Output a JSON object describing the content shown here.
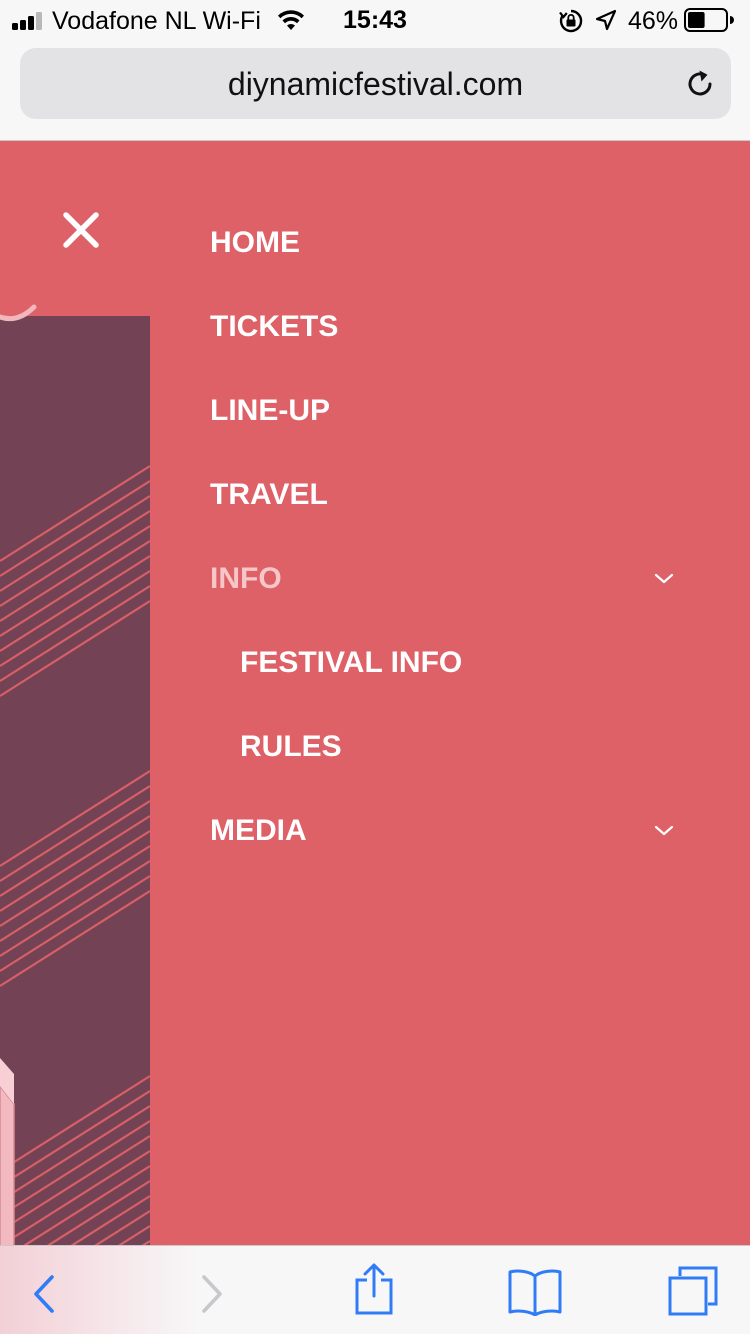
{
  "status_bar": {
    "carrier": "Vodafone NL Wi-Fi",
    "time": "15:43",
    "battery_percent": "46%",
    "battery_level": 0.46,
    "signal_bars_filled": 3,
    "signal_bars_total": 4
  },
  "url_bar": {
    "url": "diynamicfestival.com",
    "reload_icon": "reload-icon"
  },
  "menu": {
    "close_icon": "close-icon",
    "items": [
      {
        "label": "HOME"
      },
      {
        "label": "TICKETS"
      },
      {
        "label": "LINE-UP"
      },
      {
        "label": "TRAVEL"
      },
      {
        "label": "INFO",
        "active": true,
        "expanded": true
      },
      {
        "label": "FESTIVAL INFO",
        "sub": true
      },
      {
        "label": "RULES",
        "sub": true
      },
      {
        "label": "MEDIA",
        "expanded": false
      }
    ]
  },
  "toolbar": {
    "back_icon": "back-arrow-icon",
    "forward_icon": "forward-arrow-icon",
    "share_icon": "share-icon",
    "bookmarks_icon": "bookmarks-icon",
    "tabs_icon": "tabs-icon"
  },
  "colors": {
    "menu_background": "#dd6167",
    "hero_background": "#734355",
    "active_item": "#f6c6c8",
    "toolbar_accent": "#2f7cf6"
  }
}
